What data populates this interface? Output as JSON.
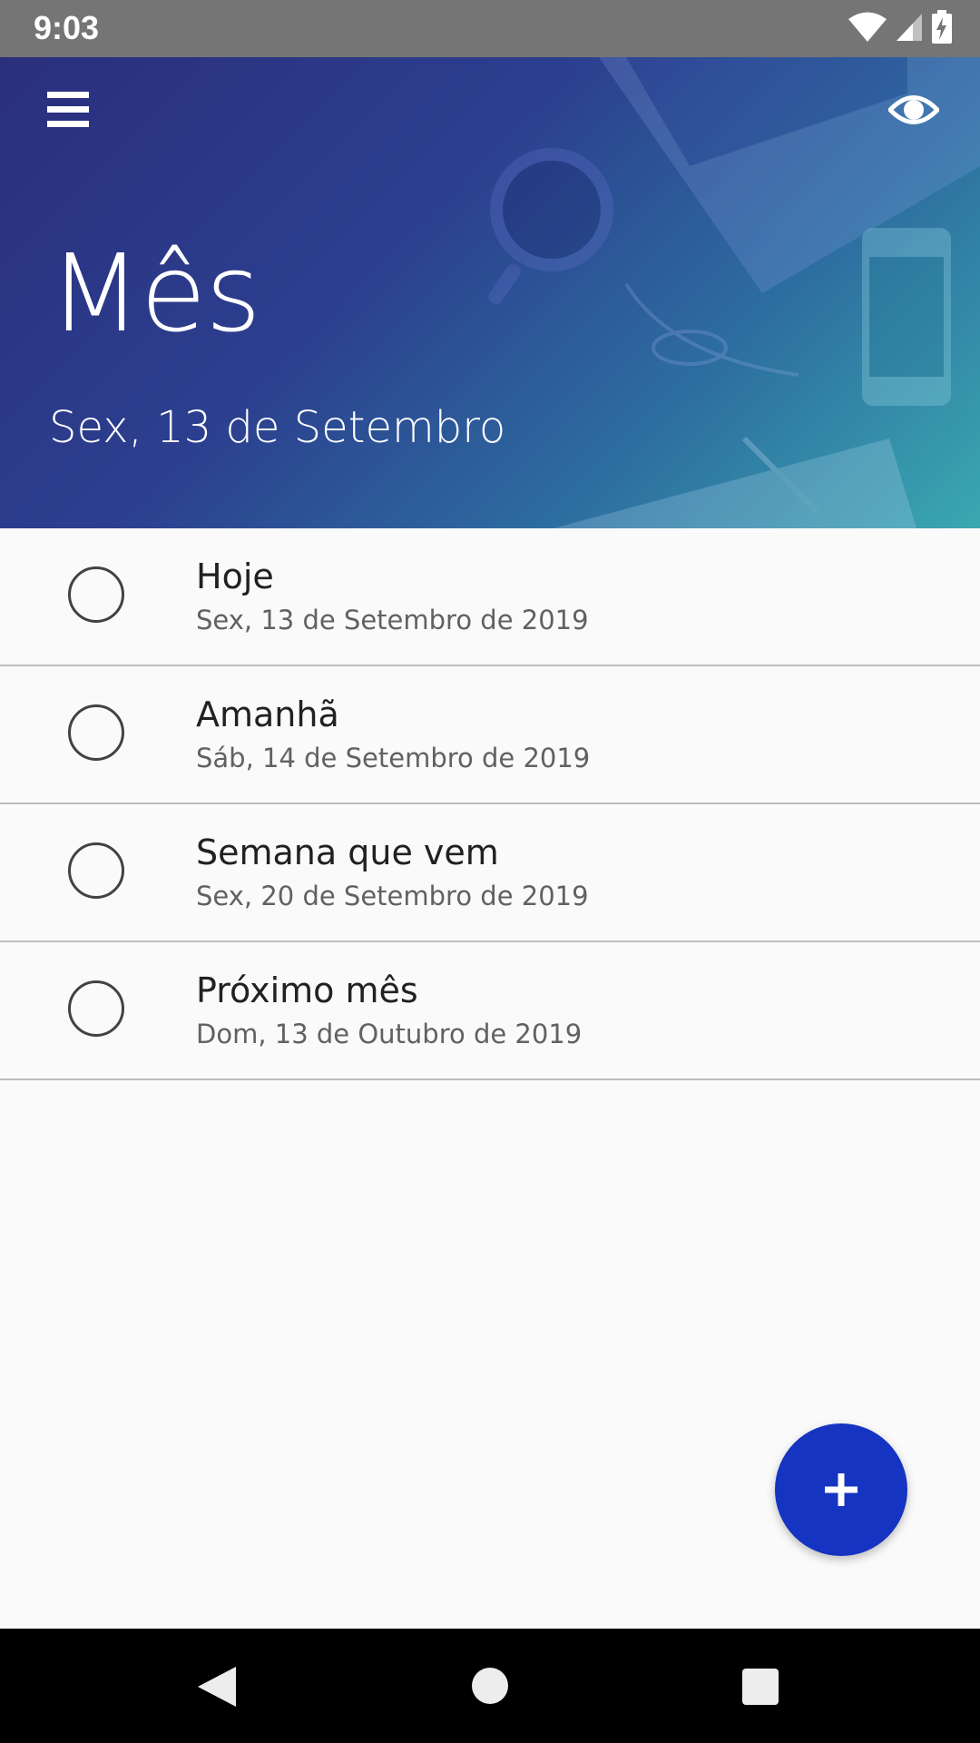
{
  "status_bar": {
    "time": "9:03",
    "icons": [
      "wifi-icon",
      "cell-signal-icon",
      "battery-charging-icon"
    ]
  },
  "header": {
    "title": "Mês",
    "subtitle": "Sex, 13 de Setembro",
    "menu_icon": "hamburger-menu-icon",
    "visibility_icon": "eye-icon",
    "gradient_colors": [
      "#2a2f7d",
      "#2d6da0",
      "#3aa8b0"
    ]
  },
  "list": {
    "items": [
      {
        "title": "Hoje",
        "date": "Sex, 13 de Setembro de 2019"
      },
      {
        "title": "Amanhã",
        "date": "Sáb, 14 de Setembro de 2019"
      },
      {
        "title": "Semana que vem",
        "date": "Sex, 20 de Setembro de 2019"
      },
      {
        "title": "Próximo mês",
        "date": "Dom, 13 de Outubro de 2019"
      }
    ]
  },
  "fab": {
    "icon": "plus-icon",
    "color": "#1534c1"
  },
  "nav_bar": {
    "icons": [
      "back-icon",
      "home-icon",
      "recents-icon"
    ]
  }
}
